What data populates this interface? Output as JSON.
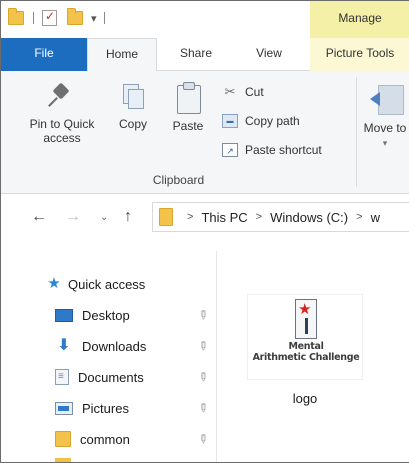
{
  "title_bar": {
    "contextual_tab": "Manage"
  },
  "ribbon_tabs": {
    "file": "File",
    "home": "Home",
    "share": "Share",
    "view": "View",
    "picture_tools": "Picture Tools"
  },
  "clipboard": {
    "pin_to_quick_access": "Pin to Quick access",
    "copy": "Copy",
    "paste": "Paste",
    "cut": "Cut",
    "copy_path": "Copy path",
    "paste_shortcut": "Paste shortcut",
    "group_label": "Clipboard"
  },
  "organize": {
    "move_to": "Move to",
    "move_to_arrow": "▾"
  },
  "address_bar": {
    "crumbs": [
      "This PC",
      "Windows (C:)",
      "w"
    ],
    "separator": ">"
  },
  "nav_pane": {
    "quick_access": "Quick access",
    "items": [
      {
        "label": "Desktop",
        "icon": "desktop-icon",
        "pinned": true
      },
      {
        "label": "Downloads",
        "icon": "downloads-icon",
        "pinned": true
      },
      {
        "label": "Documents",
        "icon": "documents-icon",
        "pinned": true
      },
      {
        "label": "Pictures",
        "icon": "pictures-icon",
        "pinned": true
      },
      {
        "label": "common",
        "icon": "folder-icon",
        "pinned": true
      }
    ]
  },
  "content": {
    "file": {
      "name": "logo",
      "thumbnail_text_line1": "Mental",
      "thumbnail_text_line2": "Arithmetic Challenge"
    }
  },
  "colors": {
    "file_tab": "#1c6dc0",
    "manage_tab": "#f4f0a8",
    "ribbon_bg": "#f5f6f7",
    "folder": "#f3c24a"
  }
}
